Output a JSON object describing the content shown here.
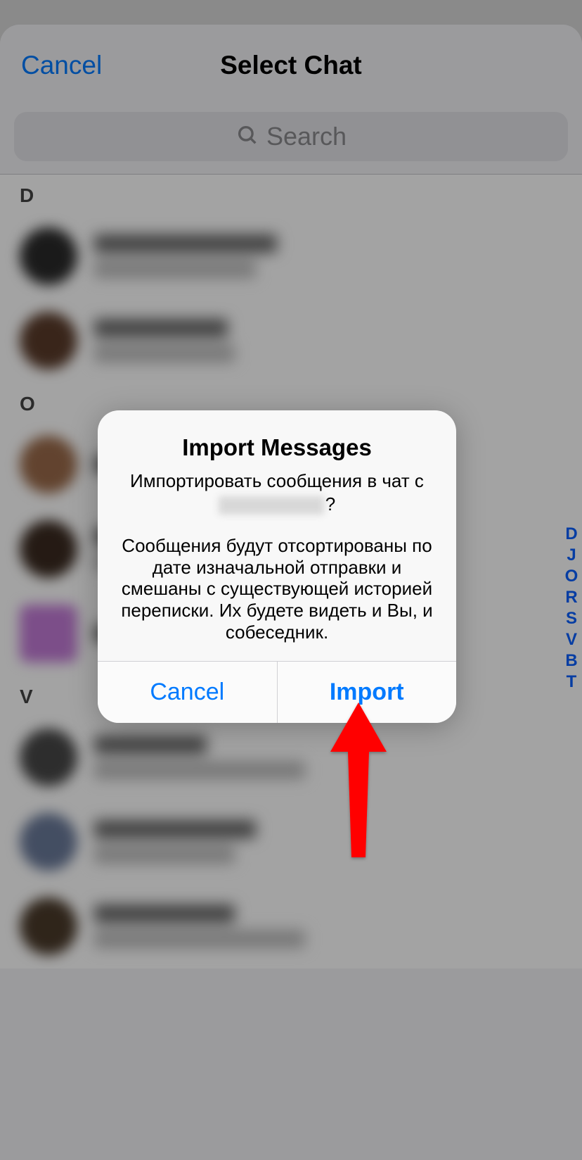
{
  "header": {
    "cancel_label": "Cancel",
    "title": "Select Chat"
  },
  "search": {
    "placeholder": "Search"
  },
  "sections": {
    "D": "D",
    "O": "O",
    "V": "V"
  },
  "index": [
    "D",
    "J",
    "O",
    "R",
    "S",
    "V",
    "B",
    "T"
  ],
  "alert": {
    "title": "Import Messages",
    "prompt_prefix": "Импортировать сообщения в чат с ",
    "prompt_suffix": "?",
    "body": "Сообщения будут отсортированы по дате изначальной отправки и смешаны с существующей историей переписки. Их будете видеть и Вы, и собеседник.",
    "cancel": "Cancel",
    "import": "Import"
  }
}
